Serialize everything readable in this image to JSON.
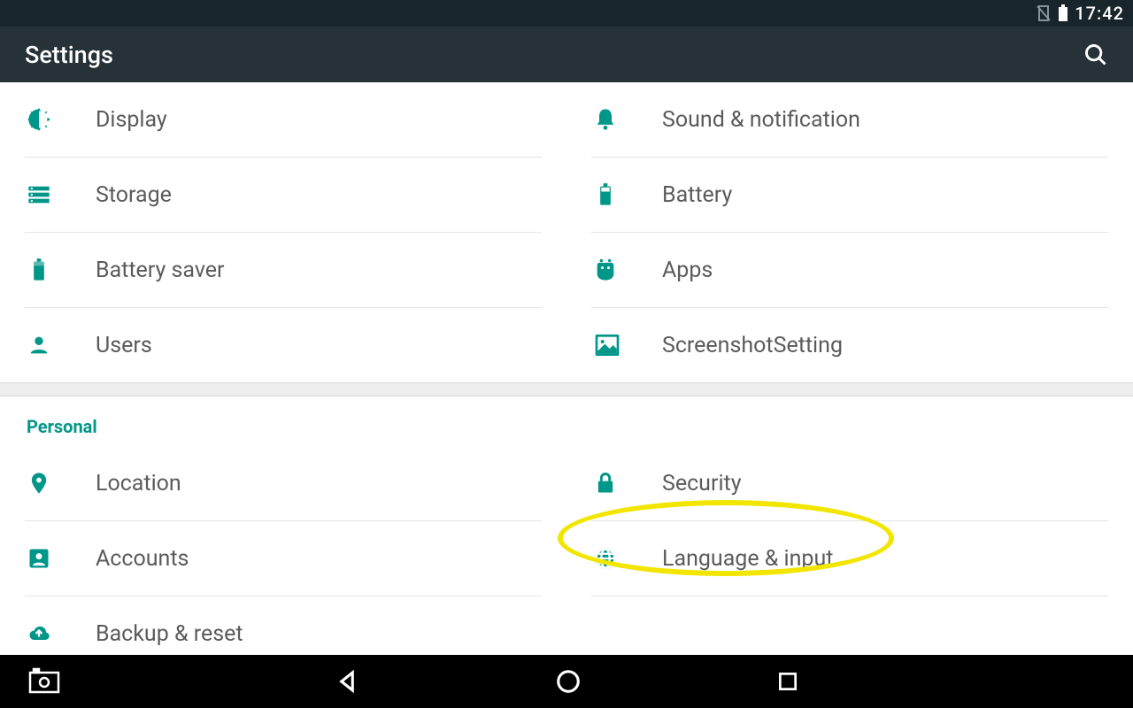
{
  "statusbar": {
    "time": "17:42"
  },
  "appbar": {
    "title": "Settings"
  },
  "device_section": {
    "left": [
      {
        "label": "Display"
      },
      {
        "label": "Storage"
      },
      {
        "label": "Battery saver"
      },
      {
        "label": "Users"
      }
    ],
    "right": [
      {
        "label": "Sound & notification"
      },
      {
        "label": "Battery"
      },
      {
        "label": "Apps"
      },
      {
        "label": "ScreenshotSetting"
      }
    ]
  },
  "personal_section": {
    "header": "Personal",
    "left": [
      {
        "label": "Location"
      },
      {
        "label": "Accounts"
      },
      {
        "label": "Backup & reset"
      }
    ],
    "right": [
      {
        "label": "Security"
      },
      {
        "label": "Language & input"
      }
    ]
  },
  "colors": {
    "accent": "#009688",
    "statusbar_bg": "#18252a",
    "appbar_bg": "#263238",
    "highlight": "#f2e500"
  }
}
